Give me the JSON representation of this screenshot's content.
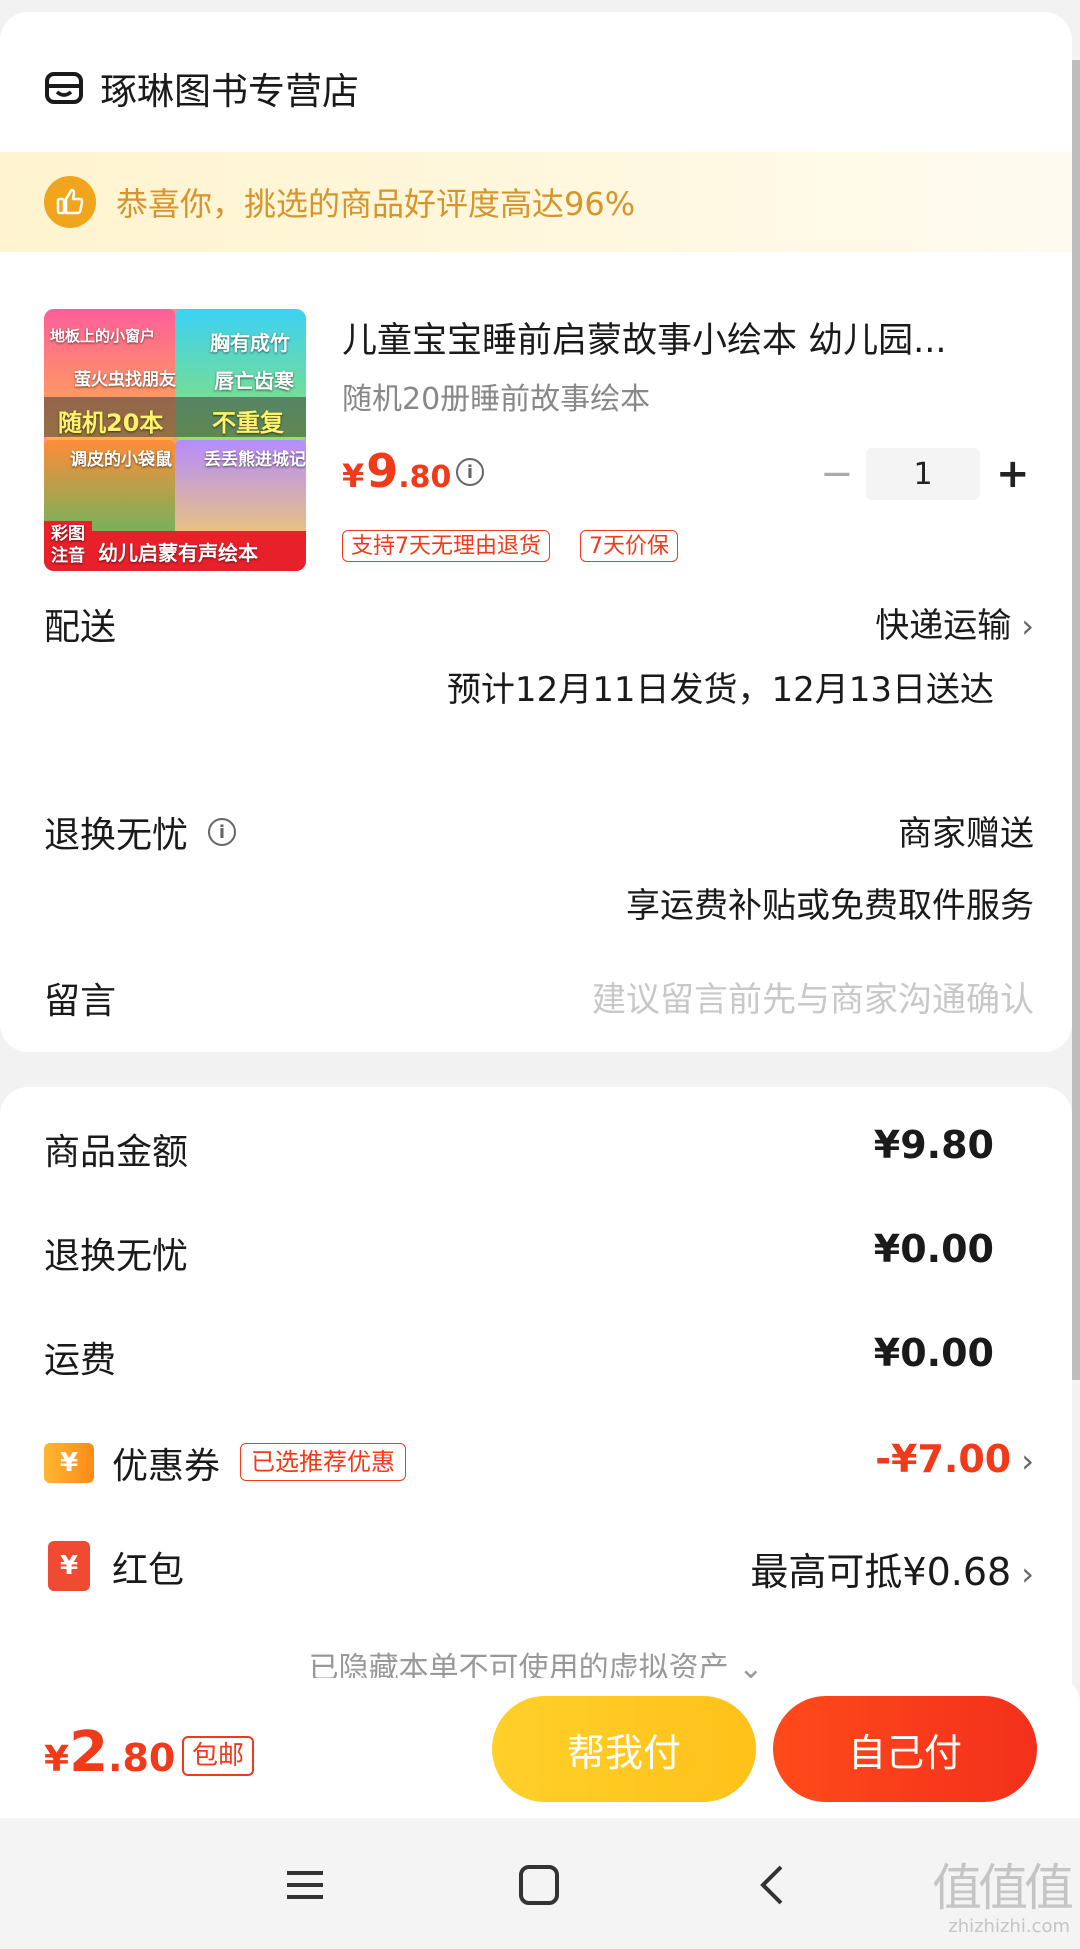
{
  "store": {
    "name": "琢琳图书专营店",
    "icon": "store-icon"
  },
  "banner": {
    "text": "恭喜你，挑选的商品好评度高达96%",
    "icon": "thumbs-up-icon"
  },
  "product": {
    "image_labels": [
      "地板上的小窗户",
      "胸有成竹",
      "萤火虫找朋友",
      "唇亡齿寒",
      "随机20本",
      "不重复",
      "调皮的小袋鼠",
      "丢丢熊进城记",
      "彩图注音",
      "幼儿启蒙有声绘本"
    ],
    "title": "儿童宝宝睡前启蒙故事小绘本 幼儿园...",
    "spec": "随机20册睡前故事绘本",
    "price_currency": "¥",
    "price_int": "9",
    "price_dec": ".80",
    "quantity": "1",
    "qty_minus": "−",
    "qty_plus": "+",
    "tags": [
      "支持7天无理由退货",
      "7天价保"
    ]
  },
  "delivery": {
    "label": "配送",
    "method": "快递运输",
    "estimate": "预计12月11日发货，12月13日送达"
  },
  "returns": {
    "label": "退换无忧",
    "value": "商家赠送",
    "desc": "享运费补贴或免费取件服务"
  },
  "message": {
    "label": "留言",
    "placeholder": "建议留言前先与商家沟通确认"
  },
  "summary": {
    "goods_label": "商品金额",
    "goods_value": "¥9.80",
    "returns_label": "退换无忧",
    "returns_value": "¥0.00",
    "shipping_label": "运费",
    "shipping_value": "¥0.00",
    "coupon_label": "优惠券",
    "coupon_badge": "已选推荐优惠",
    "coupon_value": "-¥7.00",
    "redpacket_label": "红包",
    "redpacket_value": "最高可抵¥0.68",
    "hidden_assets": "已隐藏本单不可使用的虚拟资产"
  },
  "footer": {
    "total_currency": "¥",
    "total_int": "2",
    "total_dec": ".80",
    "shipping_badge": "包邮",
    "help_pay": "帮我付",
    "self_pay": "自己付"
  },
  "watermark": {
    "big": "值值值",
    "small": "zhizhizhi.com"
  },
  "colors": {
    "accent_red": "#f03a1a",
    "banner_text": "#d7942b",
    "help_btn": "#ffc81f",
    "self_btn": "#f3301c"
  }
}
